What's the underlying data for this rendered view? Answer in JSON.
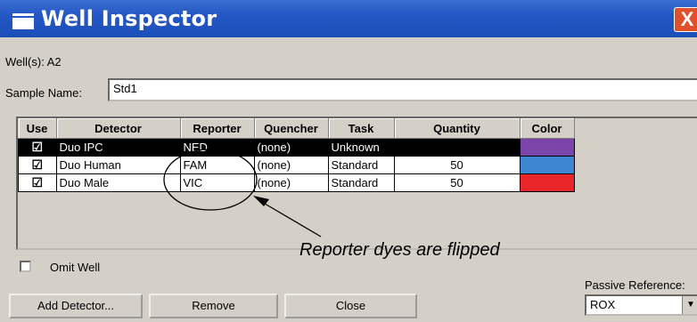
{
  "window": {
    "title": "Well Inspector",
    "close_glyph": "X"
  },
  "wells_label": "Well(s): A2",
  "sample": {
    "label": "Sample Name:",
    "value": "Std1"
  },
  "table": {
    "headers": [
      "Use",
      "Detector",
      "Reporter",
      "Quencher",
      "Task",
      "Quantity",
      "Color"
    ],
    "rows": [
      {
        "use": "☑",
        "detector": "Duo IPC",
        "reporter": "NED",
        "quencher": "(none)",
        "task": "Unknown",
        "quantity": "",
        "color": "#7b44a8",
        "selected": true
      },
      {
        "use": "☑",
        "detector": "Duo Human",
        "reporter": "FAM",
        "quencher": "(none)",
        "task": "Standard",
        "quantity": "50",
        "color": "#3c85cf",
        "selected": false
      },
      {
        "use": "☑",
        "detector": "Duo Male",
        "reporter": "VIC",
        "quencher": "(none)",
        "task": "Standard",
        "quantity": "50",
        "color": "#e8262a",
        "selected": false
      }
    ]
  },
  "omit_well_label": "Omit Well",
  "buttons": {
    "add_detector": "Add Detector...",
    "remove": "Remove",
    "close": "Close"
  },
  "passive_reference": {
    "label": "Passive Reference:",
    "value": "ROX"
  },
  "annotation": "Reporter dyes are flipped"
}
